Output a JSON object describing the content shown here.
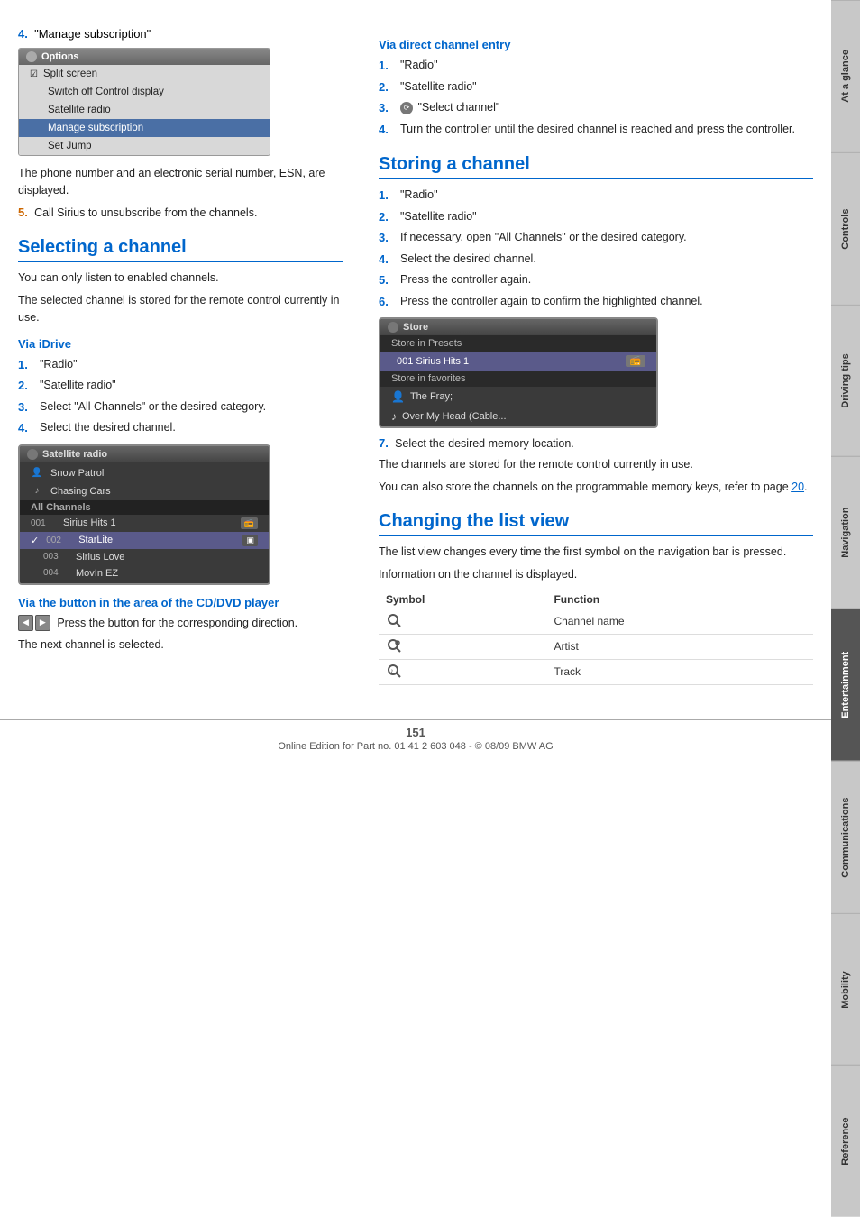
{
  "page": {
    "number": "151",
    "footer": "Online Edition for Part no. 01 41 2 603 048 - © 08/09 BMW AG"
  },
  "side_tabs": [
    {
      "id": "at-a-glance",
      "label": "At a glance",
      "active": false
    },
    {
      "id": "controls",
      "label": "Controls",
      "active": false
    },
    {
      "id": "driving-tips",
      "label": "Driving tips",
      "active": false
    },
    {
      "id": "navigation",
      "label": "Navigation",
      "active": false
    },
    {
      "id": "entertainment",
      "label": "Entertainment",
      "active": true
    },
    {
      "id": "communications",
      "label": "Communications",
      "active": false
    },
    {
      "id": "mobility",
      "label": "Mobility",
      "active": false
    },
    {
      "id": "reference",
      "label": "Reference",
      "active": false
    }
  ],
  "left_col": {
    "step4_label": "4.",
    "step4_text": "\"Manage subscription\"",
    "options_title": "Options",
    "options_menu": [
      {
        "text": "Split screen",
        "icon": "checkbox",
        "selected": false
      },
      {
        "text": "Switch off Control display",
        "selected": false
      },
      {
        "text": "Satellite radio",
        "selected": false
      },
      {
        "text": "Manage subscription",
        "selected": true
      },
      {
        "text": "Set Jump",
        "selected": false
      }
    ],
    "para1": "The phone number and an electronic serial number, ESN, are displayed.",
    "step5_label": "5.",
    "step5_text": "Call Sirius to unsubscribe from the channels.",
    "selecting_heading": "Selecting a channel",
    "selecting_para1": "You can only listen to enabled channels.",
    "selecting_para2": "The selected channel is stored for the remote control currently in use.",
    "via_idrive_heading": "Via iDrive",
    "idrive_steps": [
      {
        "num": "1.",
        "text": "\"Radio\""
      },
      {
        "num": "2.",
        "text": "\"Satellite radio\""
      },
      {
        "num": "3.",
        "text": "Select \"All Channels\" or the desired category."
      },
      {
        "num": "4.",
        "text": "Select the desired channel."
      }
    ],
    "sat_ui_title": "Satellite radio",
    "sat_ui_items": [
      {
        "icon": "person",
        "text": "Snow Patrol",
        "num": "",
        "check": false
      },
      {
        "icon": "music",
        "text": "Chasing Cars",
        "num": "",
        "check": false
      },
      {
        "separator": "All Channels"
      },
      {
        "num": "001",
        "text": "Sirius Hits 1",
        "check": false,
        "badge": ""
      },
      {
        "num": "002",
        "text": "StarLite",
        "check": true,
        "badge": "small"
      },
      {
        "num": "003",
        "text": "Sirius Love",
        "check": false
      },
      {
        "num": "004",
        "text": "MovIn EZ",
        "check": false
      }
    ],
    "via_dvd_heading": "Via the button in the area of the CD/DVD player",
    "via_dvd_para": "Press the button for the corresponding direction.",
    "via_dvd_para2": "The next channel is selected."
  },
  "right_col": {
    "via_direct_heading": "Via direct channel entry",
    "direct_steps": [
      {
        "num": "1.",
        "text": "\"Radio\""
      },
      {
        "num": "2.",
        "text": "\"Satellite radio\""
      },
      {
        "num": "3.",
        "text": "\"Select channel\"",
        "icon": "controller"
      },
      {
        "num": "4.",
        "text": "Turn the controller until the desired channel is reached and press the controller."
      }
    ],
    "storing_heading": "Storing a channel",
    "storing_steps": [
      {
        "num": "1.",
        "text": "\"Radio\""
      },
      {
        "num": "2.",
        "text": "\"Satellite radio\""
      },
      {
        "num": "3.",
        "text": "If necessary, open \"All Channels\" or the desired category."
      },
      {
        "num": "4.",
        "text": "Select the desired channel."
      },
      {
        "num": "5.",
        "text": "Press the controller again."
      },
      {
        "num": "6.",
        "text": "Press the controller again to confirm the highlighted channel."
      }
    ],
    "store_ui_title": "Store",
    "store_ui_sections": [
      {
        "section": "Store in Presets"
      },
      {
        "item": "001  Sirius Hits 1",
        "badge": "preset",
        "selected": true
      },
      {
        "section": "Store in favorites"
      },
      {
        "item": "The Fray;",
        "badge": "person",
        "selected": false
      },
      {
        "item": "Over My Head (Cable...",
        "badge": "music",
        "selected": false
      }
    ],
    "step7_label": "7.",
    "step7_text": "Select the desired memory location.",
    "storing_para1": "The channels are stored for the remote control currently in use.",
    "storing_para2": "You can also store the channels on the programmable memory keys, refer to page 20.",
    "changing_heading": "Changing the list view",
    "changing_para1": "The list view changes every time the first symbol on the navigation bar is pressed.",
    "changing_para2": "Information on the channel is displayed.",
    "table": {
      "col1": "Symbol",
      "col2": "Function",
      "rows": [
        {
          "symbol": "🔍",
          "function": "Channel name"
        },
        {
          "symbol": "🔍",
          "function": "Artist"
        },
        {
          "symbol": "🔍",
          "function": "Track"
        }
      ]
    }
  }
}
